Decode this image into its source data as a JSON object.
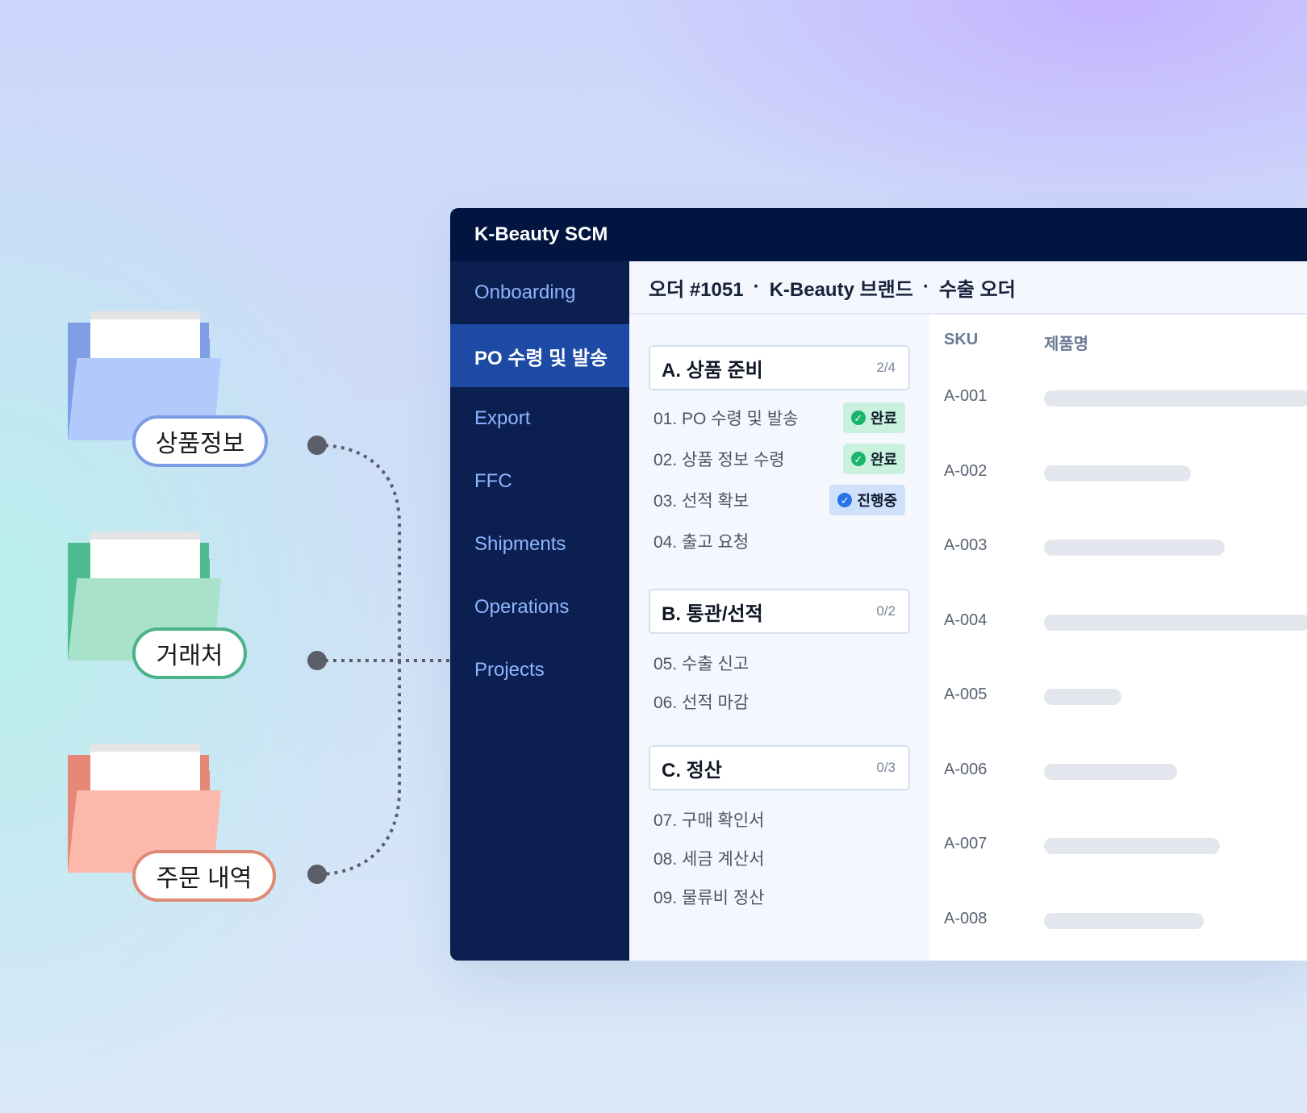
{
  "sources": [
    {
      "label": "상품정보",
      "color": "blue"
    },
    {
      "label": "거래처",
      "color": "green"
    },
    {
      "label": "주문 내역",
      "color": "red"
    }
  ],
  "app": {
    "title": "K-Beauty SCM"
  },
  "sidebar": {
    "items": [
      {
        "label": "Onboarding",
        "active": false
      },
      {
        "label": "PO 수령 및 발송",
        "active": true
      },
      {
        "label": "Export",
        "active": false
      },
      {
        "label": "FFC",
        "active": false
      },
      {
        "label": "Shipments",
        "active": false
      },
      {
        "label": "Operations",
        "active": false
      },
      {
        "label": "Projects",
        "active": false
      }
    ]
  },
  "header": {
    "order": "오더 #1051",
    "separator": "·",
    "brand": "K-Beauty 브랜드",
    "type": "수출 오더"
  },
  "sections": [
    {
      "title": "A. 상품 준비",
      "count": "2/4",
      "tasks": [
        {
          "label": "01. PO 수령 및 발송",
          "status": "완료",
          "state": "done"
        },
        {
          "label": "02. 상품 정보 수령",
          "status": "완료",
          "state": "done"
        },
        {
          "label": "03. 선적 확보",
          "status": "진행중",
          "state": "progress"
        },
        {
          "label": "04. 출고 요청",
          "status": "",
          "state": "none"
        }
      ]
    },
    {
      "title": "B. 통관/선적",
      "count": "0/2",
      "tasks": [
        {
          "label": "05. 수출 신고",
          "status": "",
          "state": "none"
        },
        {
          "label": "06. 선적 마감",
          "status": "",
          "state": "none"
        }
      ]
    },
    {
      "title": "C. 정산",
      "count": "0/3",
      "tasks": [
        {
          "label": "07. 구매 확인서",
          "status": "",
          "state": "none"
        },
        {
          "label": "08. 세금 계산서",
          "status": "",
          "state": "none"
        },
        {
          "label": "09. 물류비 정산",
          "status": "",
          "state": "none"
        }
      ]
    }
  ],
  "table": {
    "columns": [
      "SKU",
      "제품명"
    ],
    "rows": [
      {
        "sku": "A-001",
        "name_fill": 1.0
      },
      {
        "sku": "A-002",
        "name_fill": 0.55
      },
      {
        "sku": "A-003",
        "name_fill": 0.68
      },
      {
        "sku": "A-004",
        "name_fill": 1.0
      },
      {
        "sku": "A-005",
        "name_fill": 0.29
      },
      {
        "sku": "A-006",
        "name_fill": 0.5
      },
      {
        "sku": "A-007",
        "name_fill": 0.66
      },
      {
        "sku": "A-008",
        "name_fill": 0.6
      }
    ]
  },
  "colors": {
    "titlebar": "#021541",
    "sidebar": "#0b2050",
    "sidebar_active": "#1d4aa4",
    "status_done": "#c9f1dd",
    "status_progress": "#cfe0fb"
  },
  "icons": {
    "status_done": "check-circle-icon",
    "status_progress": "check-circle-icon",
    "source": "folder-icon"
  }
}
